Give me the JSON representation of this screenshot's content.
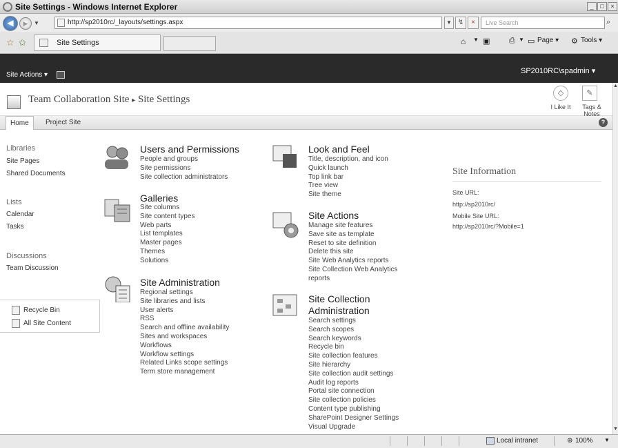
{
  "window": {
    "title": "Site Settings - Windows Internet Explorer"
  },
  "browser": {
    "url": "http://sp2010rc/_layouts/settings.aspx",
    "search_placeholder": "Live Search",
    "tab_title": "Site Settings",
    "toolbar": {
      "page": "Page",
      "tools": "Tools"
    }
  },
  "sharepoint": {
    "site_actions": "Site Actions",
    "user": "SP2010RC\\spadmin",
    "breadcrumb": {
      "site": "Team Collaboration Site",
      "page": "Site Settings"
    },
    "header_tools": {
      "like": "I Like It",
      "tags": "Tags &",
      "tags2": "Notes"
    },
    "topnav": [
      "Home",
      "Project Site"
    ],
    "help": "?"
  },
  "leftnav": {
    "libraries": "Libraries",
    "site_pages": "Site Pages",
    "shared_documents": "Shared Documents",
    "lists": "Lists",
    "calendar": "Calendar",
    "tasks": "Tasks",
    "discussions": "Discussions",
    "team_discussion": "Team Discussion",
    "recycle_bin": "Recycle Bin",
    "all_site_content": "All Site Content"
  },
  "groups": {
    "users": {
      "title": "Users and Permissions",
      "links": [
        "People and groups",
        "Site permissions",
        "Site collection administrators"
      ]
    },
    "galleries": {
      "title": "Galleries",
      "links": [
        "Site columns",
        "Site content types",
        "Web parts",
        "List templates",
        "Master pages",
        "Themes",
        "Solutions"
      ]
    },
    "admin": {
      "title": "Site Administration",
      "links": [
        "Regional settings",
        "Site libraries and lists",
        "User alerts",
        "RSS",
        "Search and offline availability",
        "Sites and workspaces",
        "Workflows",
        "Workflow settings",
        "Related Links scope settings",
        "Term store management"
      ]
    },
    "look": {
      "title": "Look and Feel",
      "links": [
        "Title, description, and icon",
        "Quick launch",
        "Top link bar",
        "Tree view",
        "Site theme"
      ]
    },
    "actions": {
      "title": "Site Actions",
      "links": [
        "Manage site features",
        "Save site as template",
        "Reset to site definition",
        "Delete this site",
        "Site Web Analytics reports",
        "Site Collection Web Analytics",
        "reports"
      ]
    },
    "collection": {
      "title1": "Site Collection",
      "title2": "Administration",
      "links": [
        "Search settings",
        "Search scopes",
        "Search keywords",
        "Recycle bin",
        "Site collection features",
        "Site hierarchy",
        "Site collection audit settings",
        "Audit log reports",
        "Portal site connection",
        "Site collection policies",
        "Content type publishing",
        "SharePoint Designer Settings",
        "Visual Upgrade"
      ]
    }
  },
  "site_info": {
    "title": "Site Information",
    "site_url_label": "Site URL:",
    "site_url": "http://sp2010rc/",
    "mobile_url_label": "Mobile Site URL:",
    "mobile_url": "http://sp2010rc/?Mobile=1"
  },
  "status": {
    "zone": "Local intranet",
    "zoom": "100%"
  }
}
